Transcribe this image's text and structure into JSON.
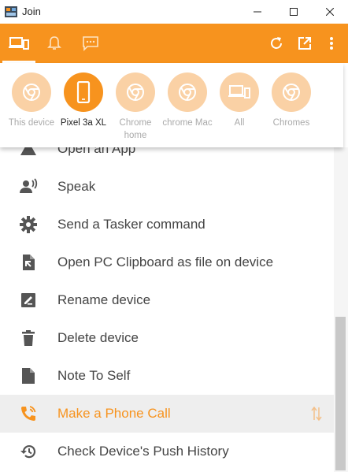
{
  "window": {
    "title": "Join"
  },
  "colors": {
    "accent": "#f7931e",
    "accent_light": "#fad1a5"
  },
  "toolbar": {
    "tabs": [
      {
        "name": "devices-tab-icon",
        "active": true
      },
      {
        "name": "notifications-tab-icon",
        "active": false
      },
      {
        "name": "sms-tab-icon",
        "active": false
      }
    ],
    "actions": [
      "refresh-icon",
      "open-external-icon",
      "more-vert-icon"
    ]
  },
  "devices": [
    {
      "label": "This device",
      "icon": "chrome-icon",
      "selected": false
    },
    {
      "label": "Pixel 3a XL",
      "icon": "phone-icon",
      "selected": true
    },
    {
      "label": "Chrome home",
      "icon": "chrome-icon",
      "selected": false
    },
    {
      "label": "chrome Mac",
      "icon": "chrome-icon",
      "selected": false
    },
    {
      "label": "All",
      "icon": "devices-icon",
      "selected": false
    },
    {
      "label": "Chromes",
      "icon": "chrome-icon",
      "selected": false
    }
  ],
  "menu": {
    "items": [
      {
        "label": "Open an App",
        "icon": "apps-icon"
      },
      {
        "label": "Speak",
        "icon": "speak-icon"
      },
      {
        "label": "Send a Tasker command",
        "icon": "gear-icon"
      },
      {
        "label": "Open PC Clipboard as file on device",
        "icon": "file-open-icon"
      },
      {
        "label": "Rename device",
        "icon": "edit-icon"
      },
      {
        "label": "Delete device",
        "icon": "trash-icon"
      },
      {
        "label": "Note To Self",
        "icon": "note-icon"
      },
      {
        "label": "Make a Phone Call",
        "icon": "phone-call-icon",
        "highlighted": true
      },
      {
        "label": "Check Device's Push History",
        "icon": "history-icon"
      }
    ]
  }
}
